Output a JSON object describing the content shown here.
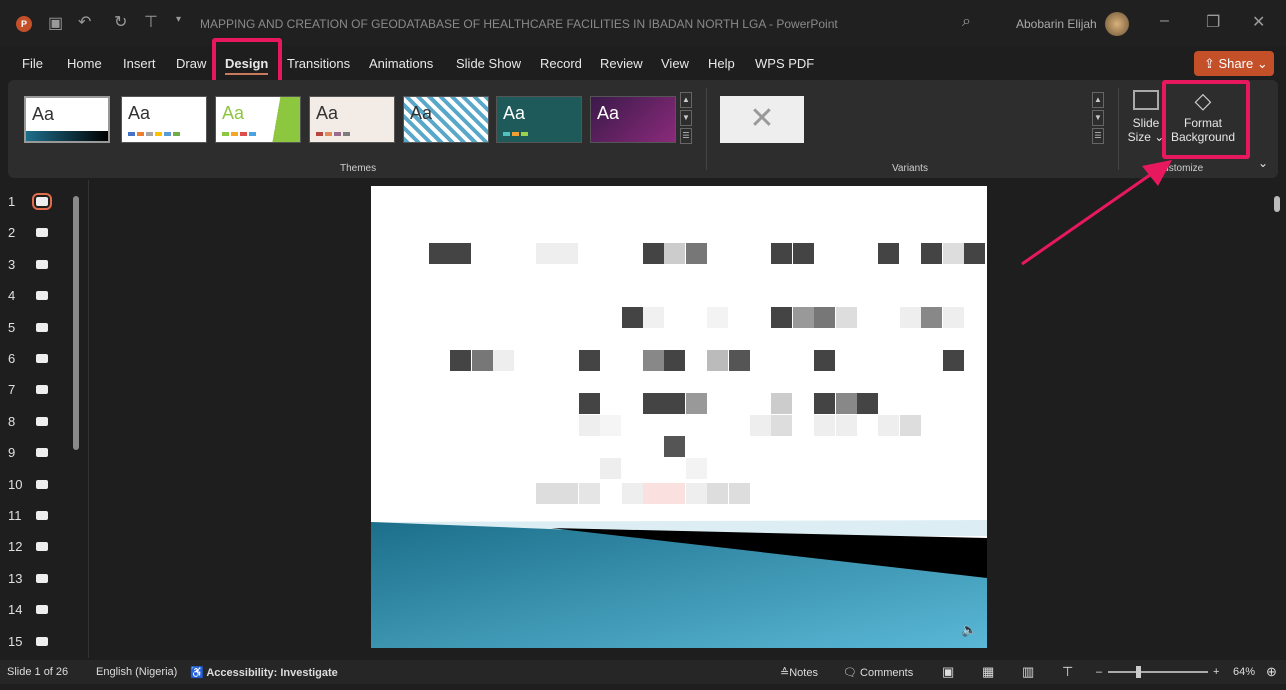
{
  "titlebar": {
    "doc_title": "MAPPING AND CREATION OF GEODATABASE OF HEALTHCARE FACILITIES IN IBADAN NORTH LGA",
    "app": "PowerPoint",
    "separator": "-",
    "user": "Abobarin Elijah"
  },
  "tabs": [
    "File",
    "Home",
    "Insert",
    "Draw",
    "Design",
    "Transitions",
    "Animations",
    "Slide Show",
    "Record",
    "Review",
    "View",
    "Help",
    "WPS PDF"
  ],
  "active_tab": "Design",
  "share_label": "Share",
  "ribbon": {
    "themes_label": "Themes",
    "theme_sample": "Aa",
    "variants_label": "Variants",
    "customize_label": "Customize",
    "slide_size": [
      "Slide",
      "Size"
    ],
    "format_background": [
      "Format",
      "Background"
    ]
  },
  "slides": [
    "1",
    "2",
    "3",
    "4",
    "5",
    "6",
    "7",
    "8",
    "9",
    "10",
    "11",
    "12",
    "13",
    "14",
    "15"
  ],
  "status": {
    "slide": "Slide 1 of 26",
    "language": "English (Nigeria)",
    "accessibility": "Accessibility: Investigate",
    "notes": "Notes",
    "comments": "Comments",
    "zoom": "64%"
  },
  "colors": {
    "highlight": "#e8185f",
    "accent": "#c4502a"
  }
}
